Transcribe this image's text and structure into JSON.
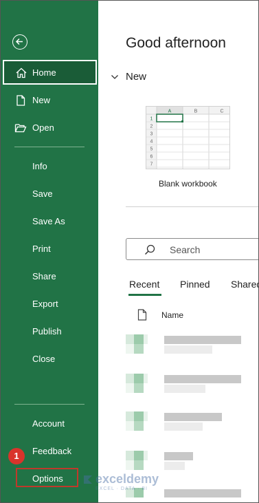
{
  "sidebar": {
    "items_top": [
      {
        "label": "Home",
        "icon": "home-icon"
      },
      {
        "label": "New",
        "icon": "new-file-icon"
      },
      {
        "label": "Open",
        "icon": "folder-open-icon"
      }
    ],
    "items_mid": [
      "Info",
      "Save",
      "Save As",
      "Print",
      "Share",
      "Export",
      "Publish",
      "Close"
    ],
    "items_bottom": [
      "Account",
      "Feedback",
      "Options"
    ],
    "annotation_badge": "1",
    "colors": {
      "background": "#217346",
      "active": "#1a5c37",
      "highlight_box": "#c0392b"
    }
  },
  "main": {
    "greeting": "Good afternoon",
    "new_section": "New",
    "blank_workbook_label": "Blank workbook",
    "thumbnail": {
      "columns": [
        "A",
        "B",
        "C"
      ],
      "rows": [
        "1",
        "2",
        "3",
        "4",
        "5",
        "6",
        "7"
      ]
    },
    "search_placeholder": "Search",
    "tabs": [
      "Recent",
      "Pinned",
      "Shared"
    ],
    "list_header": "Name"
  },
  "watermark": {
    "brand": "exceldemy",
    "tagline": "EXCEL · DATA · BI"
  }
}
